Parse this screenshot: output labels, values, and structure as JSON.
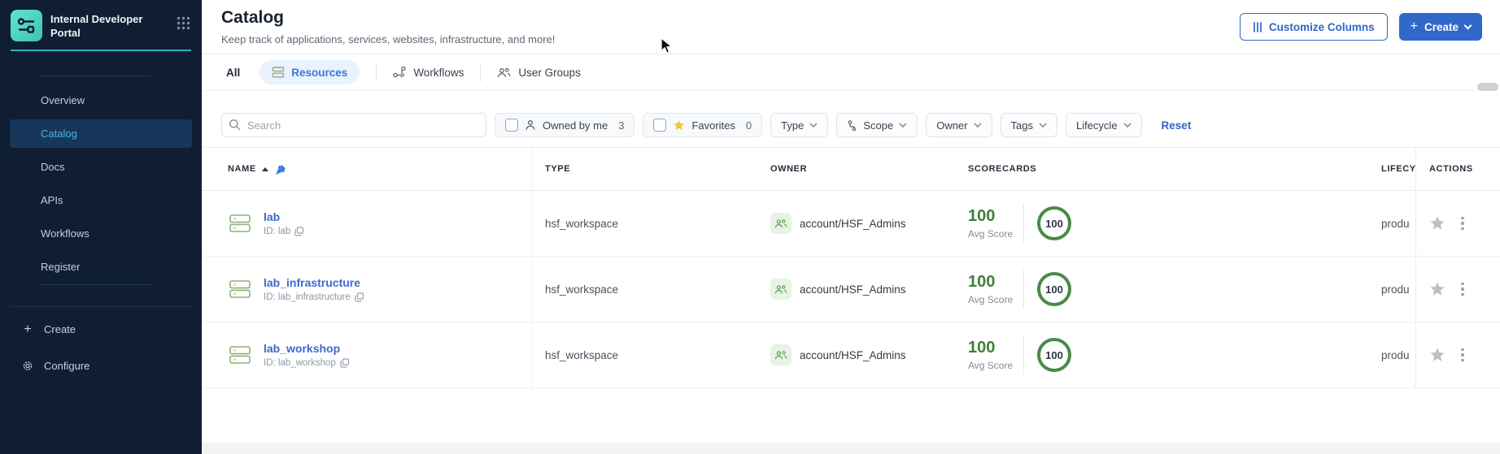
{
  "app": {
    "title": "Internal Developer Portal"
  },
  "sidebar": {
    "items": [
      {
        "label": "Overview"
      },
      {
        "label": "Catalog"
      },
      {
        "label": "Docs"
      },
      {
        "label": "APIs"
      },
      {
        "label": "Workflows"
      },
      {
        "label": "Register"
      }
    ],
    "active_item": "Catalog",
    "create_label": "Create",
    "configure_label": "Configure"
  },
  "header": {
    "title": "Catalog",
    "subtitle": "Keep track of applications, services, websites, infrastructure, and more!",
    "customize_columns_label": "Customize Columns",
    "create_label": "Create"
  },
  "tabs": [
    {
      "label": "All"
    },
    {
      "label": "Resources",
      "active": true
    },
    {
      "label": "Workflows"
    },
    {
      "label": "User Groups"
    }
  ],
  "filters": {
    "search_placeholder": "Search",
    "owned_by_me": {
      "label": "Owned by me",
      "count": "3"
    },
    "favorites": {
      "label": "Favorites",
      "count": "0"
    },
    "dropdowns": [
      {
        "label": "Type"
      },
      {
        "label": "Scope"
      },
      {
        "label": "Owner"
      },
      {
        "label": "Tags"
      },
      {
        "label": "Lifecycle"
      }
    ],
    "reset_label": "Reset"
  },
  "table": {
    "columns": {
      "name": "NAME",
      "type": "TYPE",
      "owner": "OWNER",
      "scorecards": "SCORECARDS",
      "lifecycle": "LIFECY",
      "actions": "ACTIONS"
    },
    "rows": [
      {
        "name": "lab",
        "id": "ID: lab",
        "type": "hsf_workspace",
        "owner": "account/HSF_Admins",
        "avg_score": "100",
        "avg_score_label": "Avg Score",
        "scorecard_value": "100",
        "lifecycle": "produ"
      },
      {
        "name": "lab_infrastructure",
        "id": "ID: lab_infrastructure",
        "type": "hsf_workspace",
        "owner": "account/HSF_Admins",
        "avg_score": "100",
        "avg_score_label": "Avg Score",
        "scorecard_value": "100",
        "lifecycle": "produ"
      },
      {
        "name": "lab_workshop",
        "id": "ID: lab_workshop",
        "type": "hsf_workspace",
        "owner": "account/HSF_Admins",
        "avg_score": "100",
        "avg_score_label": "Avg Score",
        "scorecard_value": "100",
        "lifecycle": "produ"
      }
    ]
  },
  "colors": {
    "accent_blue": "#3169ca",
    "link_blue": "#3c68cd",
    "teal_accent": "#2fb0c2",
    "score_green": "#3f7f3a",
    "sidebar_bg": "#0f1e33"
  }
}
